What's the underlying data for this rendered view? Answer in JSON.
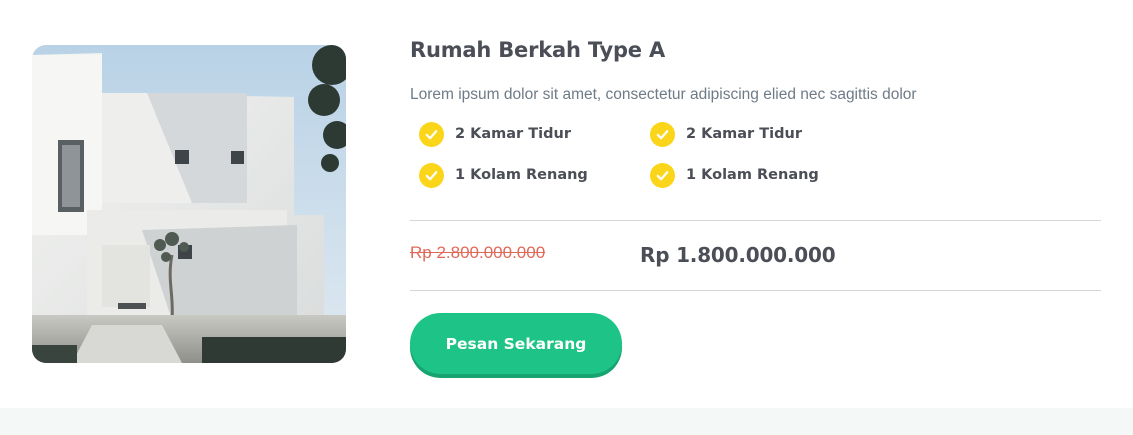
{
  "product": {
    "title": "Rumah Berkah Type A",
    "description": "Lorem ipsum dolor sit amet, consectetur adipiscing elied nec sagittis dolor",
    "image_alt": "house-photo",
    "features": [
      {
        "label": "2 Kamar Tidur",
        "icon": "check-circle-icon"
      },
      {
        "label": "2 Kamar Tidur",
        "icon": "check-circle-icon"
      },
      {
        "label": "1 Kolam Renang",
        "icon": "check-circle-icon"
      },
      {
        "label": "1 Kolam Renang",
        "icon": "check-circle-icon"
      }
    ],
    "price_old": "Rp 2.800.000.000",
    "price_new": "Rp 1.800.000.000",
    "cta_label": "Pesan Sekarang"
  },
  "colors": {
    "accent": "#1ec487",
    "check": "#fbd51a",
    "old_price": "#e06a5a",
    "text": "#4b4e56"
  }
}
